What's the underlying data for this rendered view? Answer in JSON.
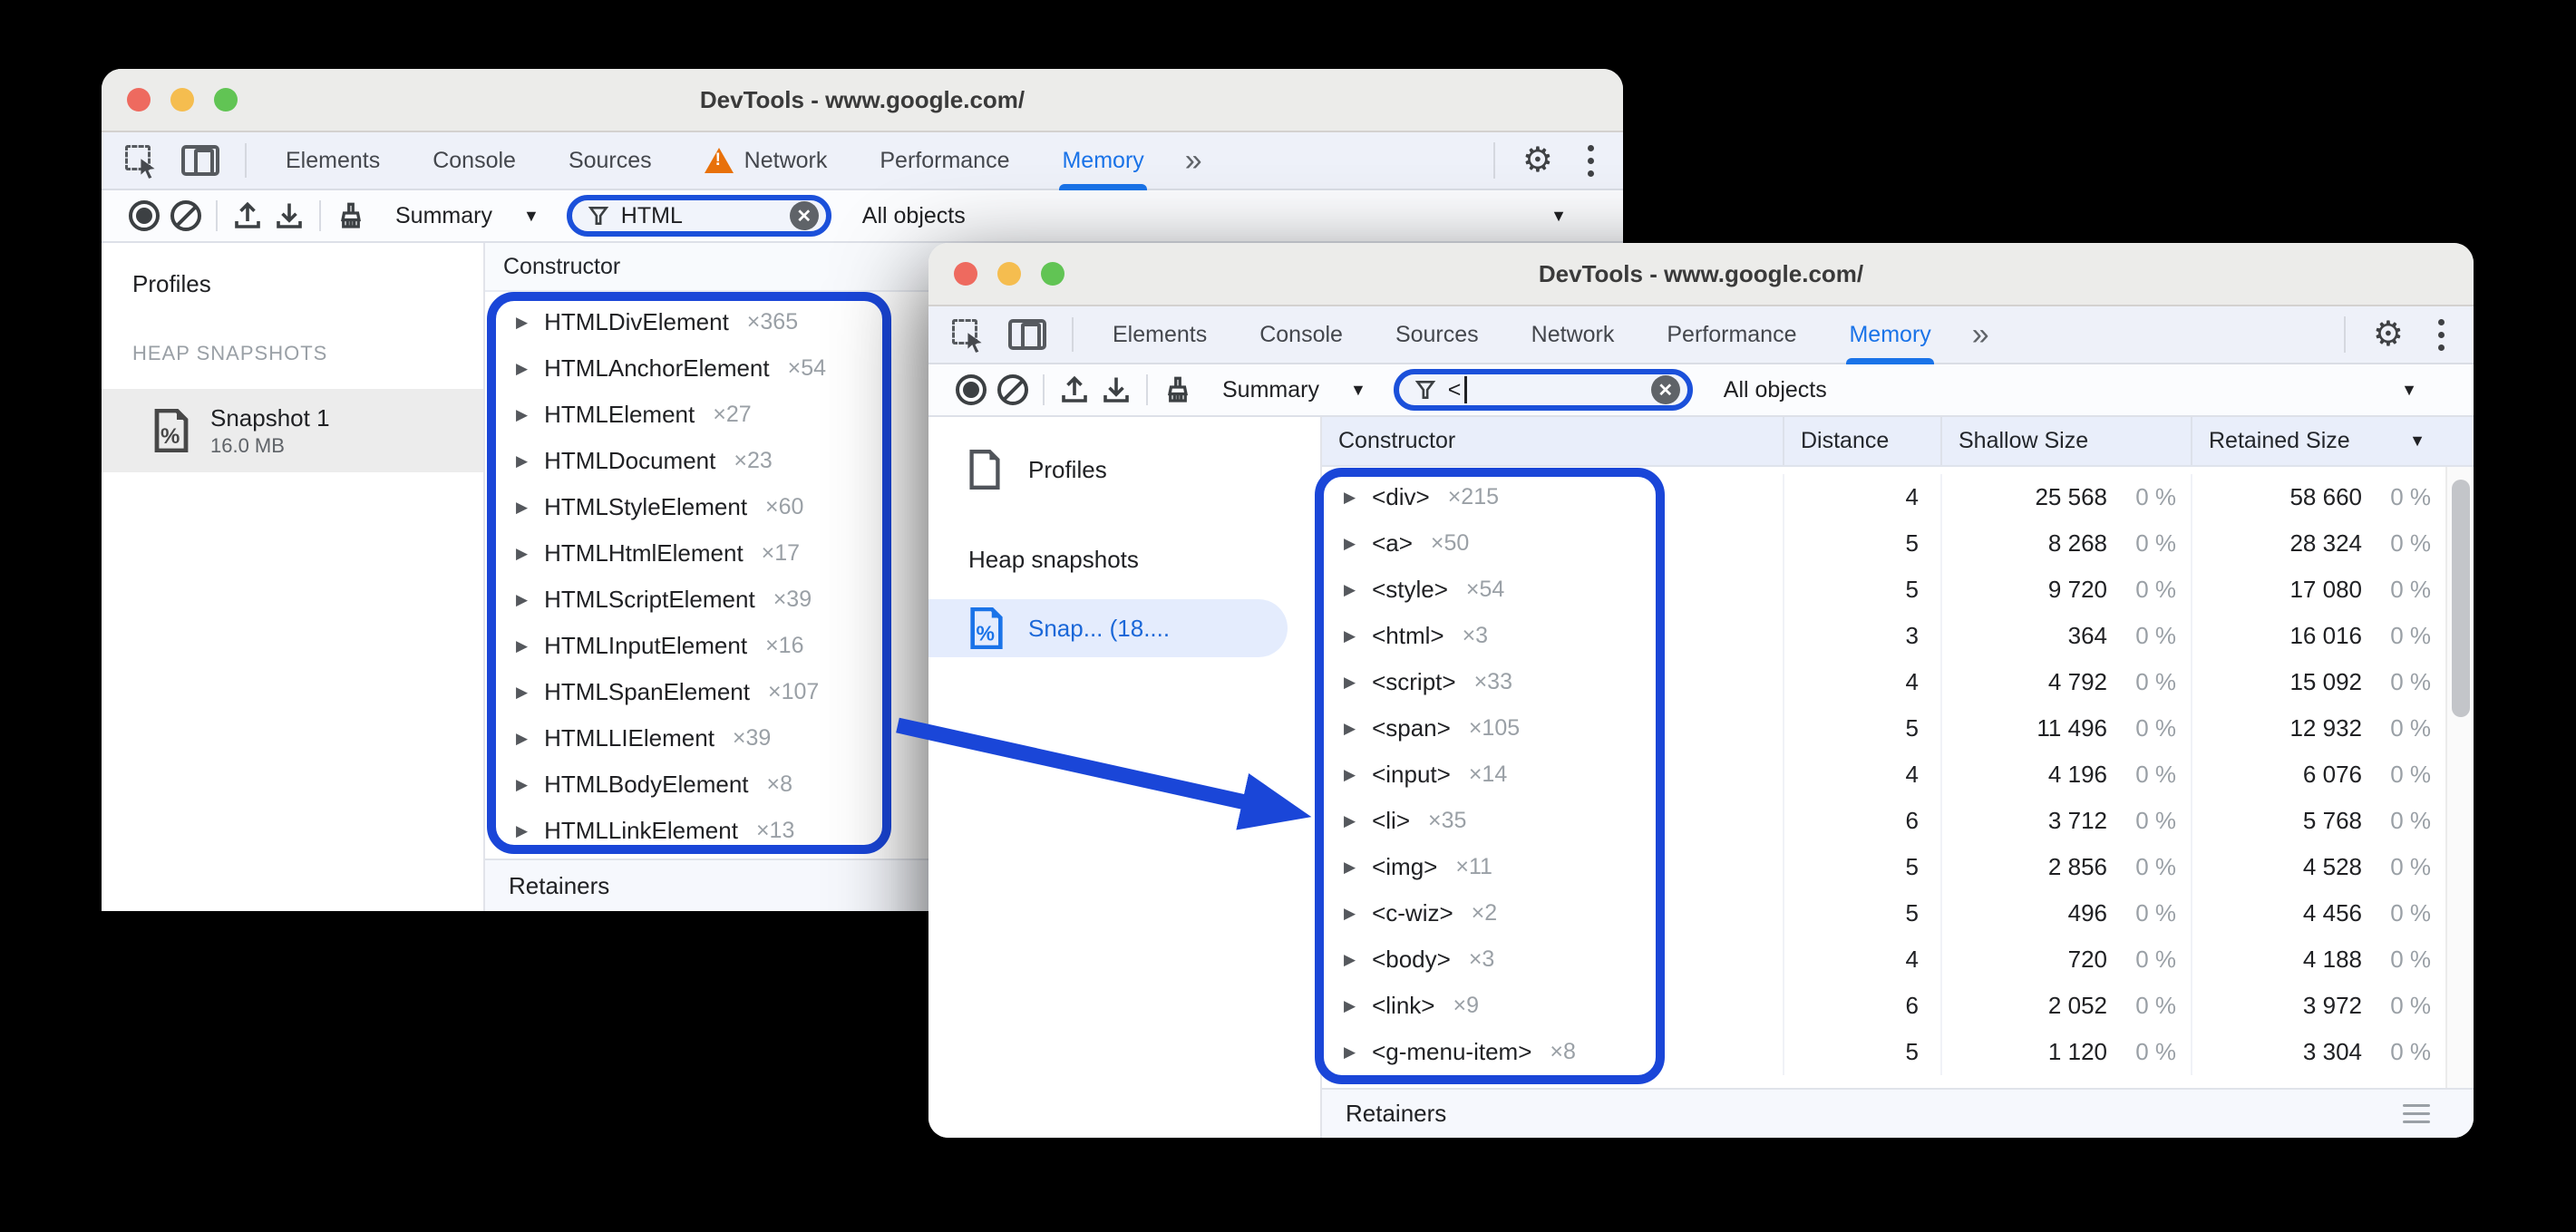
{
  "annotation": {
    "blue": "#1a46d8"
  },
  "accent": {
    "devtools_blue": "#1a73e8"
  },
  "back_window": {
    "title": "DevTools - www.google.com/",
    "tabs": {
      "elements": "Elements",
      "console": "Console",
      "sources": "Sources",
      "network": "Network",
      "performance": "Performance",
      "memory": "Memory",
      "more": "»"
    },
    "toolbar": {
      "summary_label": "Summary",
      "filter_value": "HTML",
      "objects_label": "All objects"
    },
    "sidebar": {
      "profiles_label": "Profiles",
      "section_label": "HEAP SNAPSHOTS",
      "snapshot_name": "Snapshot 1",
      "snapshot_size": "16.0 MB"
    },
    "grid": {
      "constructor_header": "Constructor",
      "retainers_label": "Retainers",
      "rows": [
        {
          "name": "HTMLDivElement",
          "count": "×365"
        },
        {
          "name": "HTMLAnchorElement",
          "count": "×54"
        },
        {
          "name": "HTMLElement",
          "count": "×27"
        },
        {
          "name": "HTMLDocument",
          "count": "×23"
        },
        {
          "name": "HTMLStyleElement",
          "count": "×60"
        },
        {
          "name": "HTMLHtmlElement",
          "count": "×17"
        },
        {
          "name": "HTMLScriptElement",
          "count": "×39"
        },
        {
          "name": "HTMLInputElement",
          "count": "×16"
        },
        {
          "name": "HTMLSpanElement",
          "count": "×107"
        },
        {
          "name": "HTMLLIElement",
          "count": "×39"
        },
        {
          "name": "HTMLBodyElement",
          "count": "×8"
        },
        {
          "name": "HTMLLinkElement",
          "count": "×13"
        }
      ]
    }
  },
  "front_window": {
    "title": "DevTools - www.google.com/",
    "tabs": {
      "elements": "Elements",
      "console": "Console",
      "sources": "Sources",
      "network": "Network",
      "performance": "Performance",
      "memory": "Memory",
      "more": "»"
    },
    "toolbar": {
      "summary_label": "Summary",
      "filter_value": "<",
      "objects_label": "All objects"
    },
    "sidebar": {
      "profiles_label": "Profiles",
      "section_label": "Heap snapshots",
      "snapshot_label": "Snap...  (18...."
    },
    "grid": {
      "headers": {
        "constructor": "Constructor",
        "distance": "Distance",
        "shallow": "Shallow Size",
        "retained": "Retained Size"
      },
      "retainers_label": "Retainers",
      "rows": [
        {
          "name": "<div>",
          "count": "×215",
          "distance": "4",
          "shallow": "25 568",
          "shallow_pct": "0 %",
          "retained": "58 660",
          "retained_pct": "0 %"
        },
        {
          "name": "<a>",
          "count": "×50",
          "distance": "5",
          "shallow": "8 268",
          "shallow_pct": "0 %",
          "retained": "28 324",
          "retained_pct": "0 %"
        },
        {
          "name": "<style>",
          "count": "×54",
          "distance": "5",
          "shallow": "9 720",
          "shallow_pct": "0 %",
          "retained": "17 080",
          "retained_pct": "0 %"
        },
        {
          "name": "<html>",
          "count": "×3",
          "distance": "3",
          "shallow": "364",
          "shallow_pct": "0 %",
          "retained": "16 016",
          "retained_pct": "0 %"
        },
        {
          "name": "<script>",
          "count": "×33",
          "distance": "4",
          "shallow": "4 792",
          "shallow_pct": "0 %",
          "retained": "15 092",
          "retained_pct": "0 %"
        },
        {
          "name": "<span>",
          "count": "×105",
          "distance": "5",
          "shallow": "11 496",
          "shallow_pct": "0 %",
          "retained": "12 932",
          "retained_pct": "0 %"
        },
        {
          "name": "<input>",
          "count": "×14",
          "distance": "4",
          "shallow": "4 196",
          "shallow_pct": "0 %",
          "retained": "6 076",
          "retained_pct": "0 %"
        },
        {
          "name": "<li>",
          "count": "×35",
          "distance": "6",
          "shallow": "3 712",
          "shallow_pct": "0 %",
          "retained": "5 768",
          "retained_pct": "0 %"
        },
        {
          "name": "<img>",
          "count": "×11",
          "distance": "5",
          "shallow": "2 856",
          "shallow_pct": "0 %",
          "retained": "4 528",
          "retained_pct": "0 %"
        },
        {
          "name": "<c-wiz>",
          "count": "×2",
          "distance": "5",
          "shallow": "496",
          "shallow_pct": "0 %",
          "retained": "4 456",
          "retained_pct": "0 %"
        },
        {
          "name": "<body>",
          "count": "×3",
          "distance": "4",
          "shallow": "720",
          "shallow_pct": "0 %",
          "retained": "4 188",
          "retained_pct": "0 %"
        },
        {
          "name": "<link>",
          "count": "×9",
          "distance": "6",
          "shallow": "2 052",
          "shallow_pct": "0 %",
          "retained": "3 972",
          "retained_pct": "0 %"
        },
        {
          "name": "<g-menu-item>",
          "count": "×8",
          "distance": "5",
          "shallow": "1 120",
          "shallow_pct": "0 %",
          "retained": "3 304",
          "retained_pct": "0 %"
        }
      ]
    }
  }
}
